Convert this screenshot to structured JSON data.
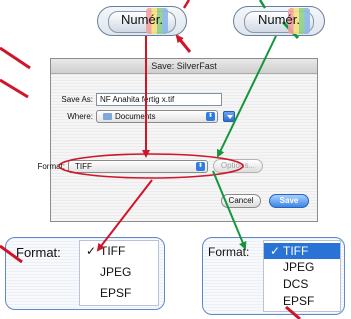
{
  "top_buttons": [
    {
      "label": "Numér."
    },
    {
      "label": "Numér."
    }
  ],
  "dialog": {
    "title": "Save: SilverFast",
    "save_as_label": "Save As:",
    "save_as_value": "NF Anahita fertig x.tif",
    "where_label": "Where:",
    "where_value": "Documents",
    "format_label": "Format:",
    "format_value": "TIFF",
    "options_label": "Options...",
    "cancel_label": "Cancel",
    "save_label": "Save"
  },
  "menu_left": {
    "format_label": "Format:",
    "items": [
      {
        "label": "TIFF",
        "checked": true
      },
      {
        "label": "JPEG",
        "checked": false
      },
      {
        "label": "EPSF",
        "checked": false
      }
    ]
  },
  "menu_right": {
    "format_label": "Format:",
    "items": [
      {
        "label": "TIFF",
        "checked": true,
        "selected": true
      },
      {
        "label": "JPEG",
        "checked": false
      },
      {
        "label": "DCS",
        "checked": false
      },
      {
        "label": "EPSF",
        "checked": false
      }
    ]
  },
  "check_mark": "✓",
  "colors": {
    "red_arrow": "#d0142a",
    "green_arrow": "#14963c",
    "highlight": "#2a73d6"
  }
}
